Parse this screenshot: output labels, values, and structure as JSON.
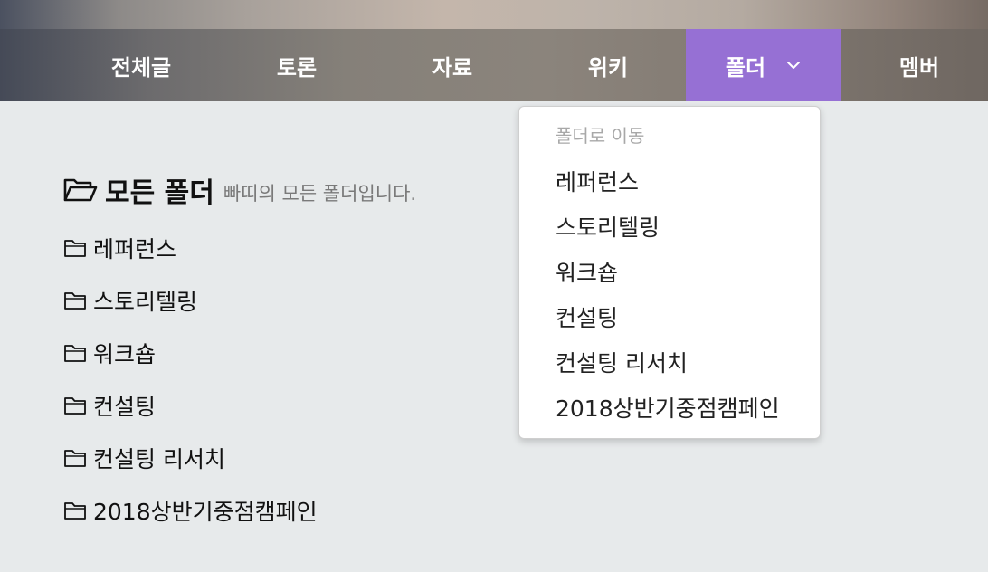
{
  "nav": {
    "items": [
      {
        "label": "전체글"
      },
      {
        "label": "토론"
      },
      {
        "label": "자료"
      },
      {
        "label": "위키"
      },
      {
        "label": "폴더"
      },
      {
        "label": "멤버"
      }
    ],
    "active_color": "#9670d4"
  },
  "main": {
    "title": "모든 폴더",
    "subtitle": "빠띠의 모든 폴더입니다.",
    "folders": [
      "레퍼런스",
      "스토리텔링",
      "워크숍",
      "컨설팅",
      "컨설팅 리서치",
      "2018상반기중점캠페인"
    ]
  },
  "dropdown": {
    "header": "폴더로 이동",
    "items": [
      "레퍼런스",
      "스토리텔링",
      "워크숍",
      "컨설팅",
      "컨설팅 리서치",
      "2018상반기중점캠페인"
    ]
  },
  "icons": {
    "heading": "folder-open-icon",
    "row": "folder-icon",
    "dropdown_toggle": "chevron-down-icon"
  }
}
